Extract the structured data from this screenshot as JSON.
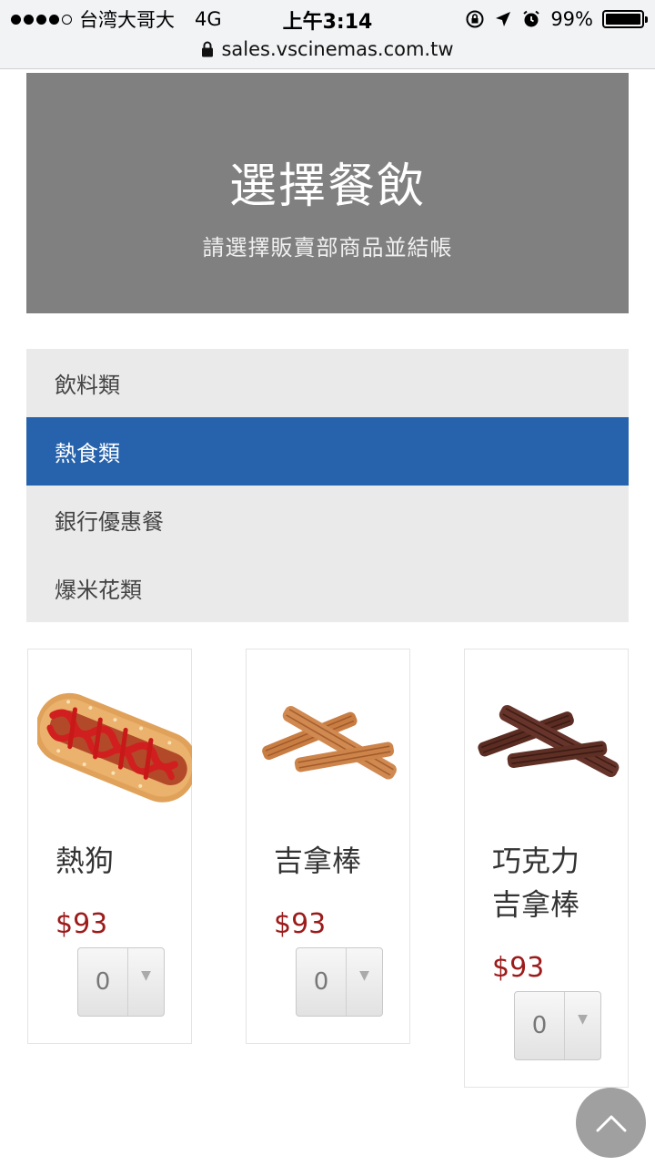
{
  "status": {
    "carrier": "台湾大哥大",
    "network": "4G",
    "time": "上午3:14",
    "battery": "99%",
    "battery_level": 0.99
  },
  "browser": {
    "url": "sales.vscinemas.com.tw"
  },
  "hero": {
    "title": "選擇餐飲",
    "subtitle": "請選擇販賣部商品並結帳"
  },
  "categories": [
    {
      "label": "飲料類",
      "active": false
    },
    {
      "label": "熱食類",
      "active": true
    },
    {
      "label": "銀行優惠餐",
      "active": false
    },
    {
      "label": "爆米花類",
      "active": false
    }
  ],
  "products": [
    {
      "name_lines": [
        "熱狗"
      ],
      "price": "$93",
      "qty": "0",
      "icon": "hotdog-icon"
    },
    {
      "name_lines": [
        "吉拿棒"
      ],
      "price": "$93",
      "qty": "0",
      "icon": "churro-icon"
    },
    {
      "name_lines": [
        "巧克力",
        "吉拿棒"
      ],
      "price": "$93",
      "qty": "0",
      "icon": "chocolate-churro-icon"
    }
  ],
  "colors": {
    "hero_bg": "#808080",
    "active_category": "#2763ac",
    "price": "#9c1b1b"
  },
  "icons": {
    "lock": "lock-icon",
    "scroll_top": "chevron-up-icon"
  }
}
